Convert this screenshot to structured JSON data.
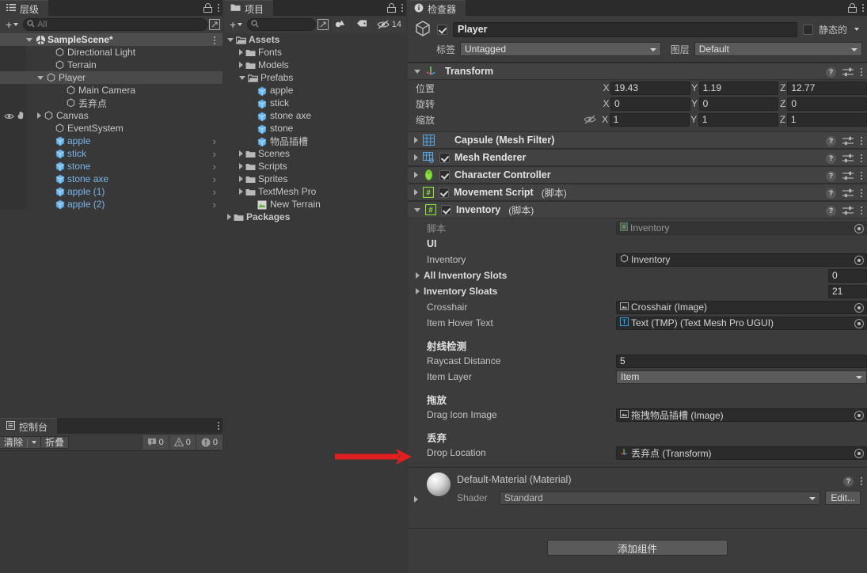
{
  "hierarchy": {
    "tab_label": "层级",
    "tab_icon": "hierarchy-icon",
    "search_placeholder": "All",
    "items": [
      {
        "label": "SampleScene*",
        "depth": 0,
        "icon": "scene-icon",
        "kind": "scene",
        "expanded": true,
        "selected": false
      },
      {
        "label": "Directional Light",
        "depth": 2,
        "icon": "gameobject-icon",
        "kind": "go"
      },
      {
        "label": "Terrain",
        "depth": 2,
        "icon": "gameobject-icon",
        "kind": "go"
      },
      {
        "label": "Player",
        "depth": 1,
        "icon": "gameobject-icon",
        "kind": "go",
        "expanded": true,
        "selected": true
      },
      {
        "label": "Main Camera",
        "depth": 3,
        "icon": "gameobject-icon",
        "kind": "go"
      },
      {
        "label": "丢弃点",
        "depth": 3,
        "icon": "gameobject-icon",
        "kind": "go"
      },
      {
        "label": "Canvas",
        "depth": 1,
        "icon": "gameobject-icon",
        "kind": "go",
        "collapsed": true,
        "vis": true
      },
      {
        "label": "EventSystem",
        "depth": 2,
        "icon": "gameobject-icon",
        "kind": "go"
      },
      {
        "label": "apple",
        "depth": 2,
        "icon": "prefab-icon",
        "kind": "prefab"
      },
      {
        "label": "stick",
        "depth": 2,
        "icon": "prefab-icon",
        "kind": "prefab"
      },
      {
        "label": "stone",
        "depth": 2,
        "icon": "prefab-icon",
        "kind": "prefab"
      },
      {
        "label": "stone axe",
        "depth": 2,
        "icon": "prefab-icon",
        "kind": "prefab"
      },
      {
        "label": "apple (1)",
        "depth": 2,
        "icon": "prefab-icon",
        "kind": "prefab"
      },
      {
        "label": "apple (2)",
        "depth": 2,
        "icon": "prefab-icon",
        "kind": "prefab"
      }
    ]
  },
  "project": {
    "tab_label": "项目",
    "tab_icon": "folder-icon",
    "search_placeholder": "",
    "hidden_count": "14",
    "items": [
      {
        "label": "Assets",
        "depth": 0,
        "icon": "folder-open-icon",
        "kind": "folder",
        "expanded": true,
        "bold": true
      },
      {
        "label": "Fonts",
        "depth": 1,
        "icon": "folder-icon",
        "kind": "folder",
        "collapsed": true
      },
      {
        "label": "Models",
        "depth": 1,
        "icon": "folder-icon",
        "kind": "folder",
        "collapsed": true
      },
      {
        "label": "Prefabs",
        "depth": 1,
        "icon": "folder-open-icon",
        "kind": "folder",
        "expanded": true
      },
      {
        "label": "apple",
        "depth": 2,
        "icon": "prefab-icon",
        "kind": "prefab"
      },
      {
        "label": "stick",
        "depth": 2,
        "icon": "prefab-icon",
        "kind": "prefab"
      },
      {
        "label": "stone axe",
        "depth": 2,
        "icon": "prefab-icon",
        "kind": "prefab"
      },
      {
        "label": "stone",
        "depth": 2,
        "icon": "prefab-icon",
        "kind": "prefab"
      },
      {
        "label": "物品插槽",
        "depth": 2,
        "icon": "prefab-icon",
        "kind": "prefab"
      },
      {
        "label": "Scenes",
        "depth": 1,
        "icon": "folder-icon",
        "kind": "folder",
        "collapsed": true
      },
      {
        "label": "Scripts",
        "depth": 1,
        "icon": "folder-icon",
        "kind": "folder",
        "collapsed": true
      },
      {
        "label": "Sprites",
        "depth": 1,
        "icon": "folder-icon",
        "kind": "folder",
        "collapsed": true
      },
      {
        "label": "TextMesh Pro",
        "depth": 1,
        "icon": "folder-icon",
        "kind": "folder",
        "collapsed": true
      },
      {
        "label": "New Terrain",
        "depth": 2,
        "icon": "terrain-asset-icon",
        "kind": "asset"
      },
      {
        "label": "Packages",
        "depth": 0,
        "icon": "folder-icon",
        "kind": "folder",
        "collapsed": true,
        "bold": true
      }
    ]
  },
  "console": {
    "tab_label": "控制台",
    "tab_icon": "console-icon",
    "clear_label": "清除",
    "collapse_label": "折叠",
    "log_count": "0",
    "warn_count": "0",
    "error_count": "0"
  },
  "inspector": {
    "tab_label": "检查器",
    "tab_icon": "info-icon",
    "object": {
      "name": "Player",
      "enabled": true,
      "static_label": "静态的",
      "tag_label": "标签",
      "tag_value": "Untagged",
      "layer_label": "图层",
      "layer_value": "Default"
    },
    "transform": {
      "title": "Transform",
      "position_label": "位置",
      "rotation_label": "旋转",
      "scale_label": "缩放",
      "position": {
        "x": "19.43",
        "y": "1.19",
        "z": "12.77"
      },
      "rotation": {
        "x": "0",
        "y": "0",
        "z": "0"
      },
      "scale": {
        "x": "1",
        "y": "1",
        "z": "1"
      },
      "axis_x": "X",
      "axis_y": "Y",
      "axis_z": "Z"
    },
    "components": [
      {
        "title": "Capsule (Mesh Filter)",
        "sub": "",
        "icon": "mesh-filter-icon",
        "has_checkbox": false,
        "expanded": false
      },
      {
        "title": "Mesh Renderer",
        "sub": "",
        "icon": "mesh-renderer-icon",
        "has_checkbox": true,
        "checked": true,
        "expanded": false
      },
      {
        "title": "Character Controller",
        "sub": "",
        "icon": "character-controller-icon",
        "has_checkbox": true,
        "checked": true,
        "expanded": false
      },
      {
        "title": "Movement Script",
        "sub": "(脚本)",
        "icon": "script-icon",
        "has_checkbox": true,
        "checked": true,
        "expanded": false
      },
      {
        "title": "Inventory",
        "sub": "(脚本)",
        "icon": "script-icon",
        "has_checkbox": true,
        "checked": true,
        "expanded": true
      }
    ],
    "inventory": {
      "script_label": "脚本",
      "script_value": "Inventory",
      "ui_header": "UI",
      "inventory_label": "Inventory",
      "inventory_value": "Inventory",
      "all_slots_label": "All Inventory Slots",
      "all_slots_value": "0",
      "slots_label": "Inventory Sloats",
      "slots_value": "21",
      "crosshair_label": "Crosshair",
      "crosshair_value": "Crosshair (Image)",
      "hover_label": "Item Hover Text",
      "hover_value": "Text (TMP) (Text Mesh Pro UGUI)",
      "raycast_header": "射线检测",
      "raycast_distance_label": "Raycast Distance",
      "raycast_distance_value": "5",
      "item_layer_label": "Item Layer",
      "item_layer_value": "Item",
      "drag_header": "拖放",
      "drag_icon_label": "Drag Icon Image",
      "drag_icon_value": "拖拽物品插槽 (Image)",
      "drop_header": "丢弃",
      "drop_location_label": "Drop Location",
      "drop_location_value": "丢弃点 (Transform)"
    },
    "material": {
      "name": "Default-Material (Material)",
      "shader_label": "Shader",
      "shader_value": "Standard",
      "edit_label": "Edit..."
    },
    "add_component_label": "添加组件"
  },
  "annotation": {
    "arrow_color": "#e02020",
    "points_to": "Drop Location"
  },
  "colors": {
    "bg": "#383838",
    "panel": "#3c3c3c",
    "header": "#424242",
    "field": "#2b2b2b",
    "select": "#4a4a4a",
    "prefab_blue": "#79b6e8",
    "accent_red": "#e02020"
  }
}
